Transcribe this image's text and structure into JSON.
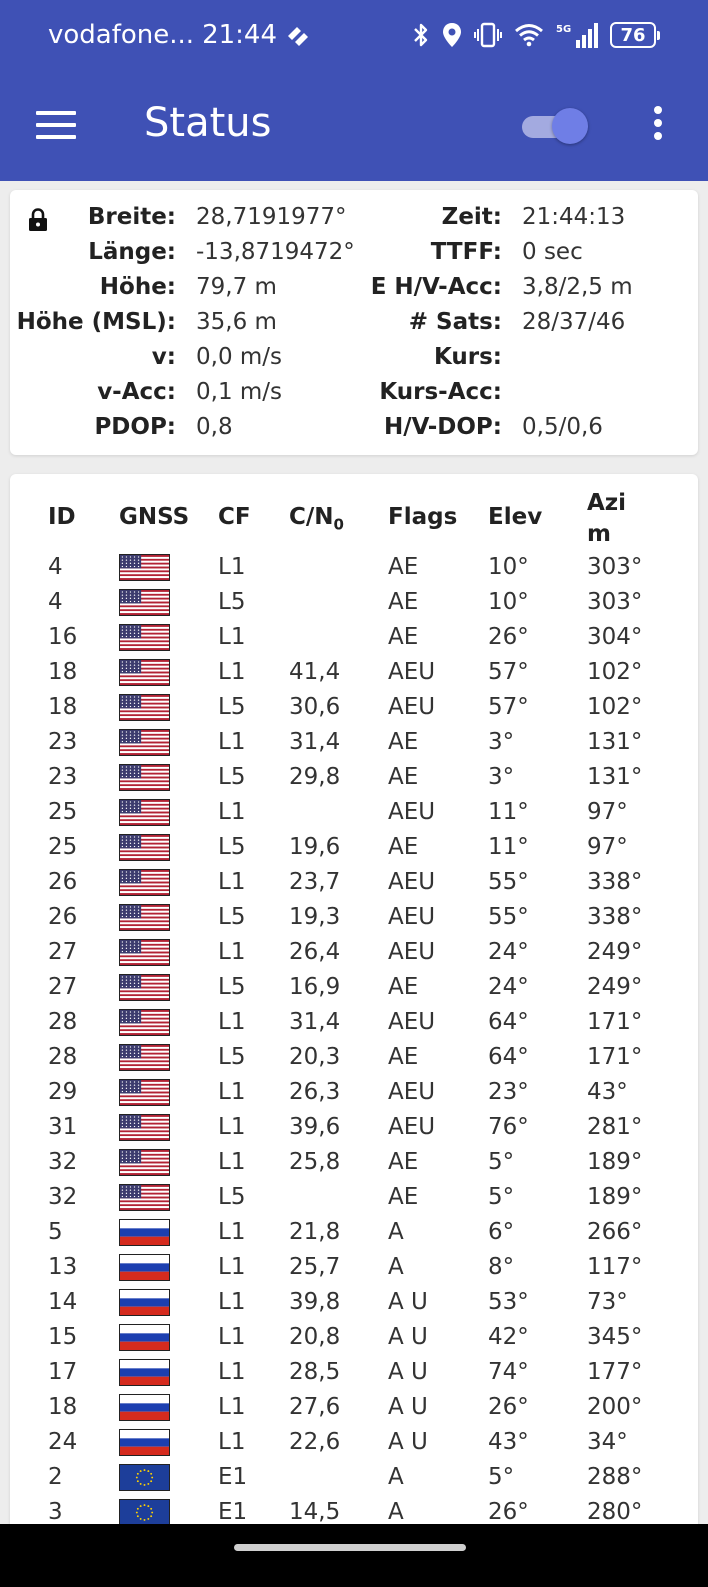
{
  "status_bar": {
    "carrier": "vodafone...",
    "time": "21:44",
    "network": "5G",
    "battery": "76"
  },
  "app_bar": {
    "title": "Status"
  },
  "position": {
    "left": [
      {
        "label": "Breite:",
        "value": "28,7191977°"
      },
      {
        "label": "Länge:",
        "value": "-13,8719472°"
      },
      {
        "label": "Höhe:",
        "value": "79,7 m"
      },
      {
        "label": "Höhe (MSL):",
        "value": "35,6 m"
      },
      {
        "label": "v:",
        "value": "0,0 m/s"
      },
      {
        "label": "v-Acc:",
        "value": "0,1 m/s"
      },
      {
        "label": "PDOP:",
        "value": "0,8"
      }
    ],
    "right": [
      {
        "label": "Zeit:",
        "value": "21:44:13"
      },
      {
        "label": "TTFF:",
        "value": "0 sec"
      },
      {
        "label": "E H/V-Acc:",
        "value": "3,8/2,5 m"
      },
      {
        "label": "# Sats:",
        "value": "28/37/46"
      },
      {
        "label": "Kurs:",
        "value": ""
      },
      {
        "label": "Kurs-Acc:",
        "value": ""
      },
      {
        "label": "H/V-DOP:",
        "value": "0,5/0,6"
      }
    ]
  },
  "satellites": {
    "columns": {
      "id": "ID",
      "gnss": "GNSS",
      "cf": "CF",
      "cn0": "C/N",
      "cn0_sub": "0",
      "flags": "Flags",
      "elev": "Elev",
      "azim_1": "Azi",
      "azim_2": "m"
    },
    "rows": [
      {
        "id": "4",
        "gnss": "us",
        "cf": "L1",
        "cn0": "",
        "flags": "AE",
        "elev": "10°",
        "azim": "303°"
      },
      {
        "id": "4",
        "gnss": "us",
        "cf": "L5",
        "cn0": "",
        "flags": "AE",
        "elev": "10°",
        "azim": "303°"
      },
      {
        "id": "16",
        "gnss": "us",
        "cf": "L1",
        "cn0": "",
        "flags": "AE",
        "elev": "26°",
        "azim": "304°"
      },
      {
        "id": "18",
        "gnss": "us",
        "cf": "L1",
        "cn0": "41,4",
        "flags": "AEU",
        "elev": "57°",
        "azim": "102°"
      },
      {
        "id": "18",
        "gnss": "us",
        "cf": "L5",
        "cn0": "30,6",
        "flags": "AEU",
        "elev": "57°",
        "azim": "102°"
      },
      {
        "id": "23",
        "gnss": "us",
        "cf": "L1",
        "cn0": "31,4",
        "flags": "AE",
        "elev": "3°",
        "azim": "131°"
      },
      {
        "id": "23",
        "gnss": "us",
        "cf": "L5",
        "cn0": "29,8",
        "flags": "AE",
        "elev": "3°",
        "azim": "131°"
      },
      {
        "id": "25",
        "gnss": "us",
        "cf": "L1",
        "cn0": "",
        "flags": "AEU",
        "elev": "11°",
        "azim": "97°"
      },
      {
        "id": "25",
        "gnss": "us",
        "cf": "L5",
        "cn0": "19,6",
        "flags": "AE",
        "elev": "11°",
        "azim": "97°"
      },
      {
        "id": "26",
        "gnss": "us",
        "cf": "L1",
        "cn0": "23,7",
        "flags": "AEU",
        "elev": "55°",
        "azim": "338°"
      },
      {
        "id": "26",
        "gnss": "us",
        "cf": "L5",
        "cn0": "19,3",
        "flags": "AEU",
        "elev": "55°",
        "azim": "338°"
      },
      {
        "id": "27",
        "gnss": "us",
        "cf": "L1",
        "cn0": "26,4",
        "flags": "AEU",
        "elev": "24°",
        "azim": "249°"
      },
      {
        "id": "27",
        "gnss": "us",
        "cf": "L5",
        "cn0": "16,9",
        "flags": "AE",
        "elev": "24°",
        "azim": "249°"
      },
      {
        "id": "28",
        "gnss": "us",
        "cf": "L1",
        "cn0": "31,4",
        "flags": "AEU",
        "elev": "64°",
        "azim": "171°"
      },
      {
        "id": "28",
        "gnss": "us",
        "cf": "L5",
        "cn0": "20,3",
        "flags": "AE",
        "elev": "64°",
        "azim": "171°"
      },
      {
        "id": "29",
        "gnss": "us",
        "cf": "L1",
        "cn0": "26,3",
        "flags": "AEU",
        "elev": "23°",
        "azim": "43°"
      },
      {
        "id": "31",
        "gnss": "us",
        "cf": "L1",
        "cn0": "39,6",
        "flags": "AEU",
        "elev": "76°",
        "azim": "281°"
      },
      {
        "id": "32",
        "gnss": "us",
        "cf": "L1",
        "cn0": "25,8",
        "flags": "AE",
        "elev": "5°",
        "azim": "189°"
      },
      {
        "id": "32",
        "gnss": "us",
        "cf": "L5",
        "cn0": "",
        "flags": "AE",
        "elev": "5°",
        "azim": "189°"
      },
      {
        "id": "5",
        "gnss": "ru",
        "cf": "L1",
        "cn0": "21,8",
        "flags": "A",
        "elev": "6°",
        "azim": "266°"
      },
      {
        "id": "13",
        "gnss": "ru",
        "cf": "L1",
        "cn0": "25,7",
        "flags": "A",
        "elev": "8°",
        "azim": "117°"
      },
      {
        "id": "14",
        "gnss": "ru",
        "cf": "L1",
        "cn0": "39,8",
        "flags": "A U",
        "elev": "53°",
        "azim": "73°"
      },
      {
        "id": "15",
        "gnss": "ru",
        "cf": "L1",
        "cn0": "20,8",
        "flags": "A U",
        "elev": "42°",
        "azim": "345°"
      },
      {
        "id": "17",
        "gnss": "ru",
        "cf": "L1",
        "cn0": "28,5",
        "flags": "A U",
        "elev": "74°",
        "azim": "177°"
      },
      {
        "id": "18",
        "gnss": "ru",
        "cf": "L1",
        "cn0": "27,6",
        "flags": "A U",
        "elev": "26°",
        "azim": "200°"
      },
      {
        "id": "24",
        "gnss": "ru",
        "cf": "L1",
        "cn0": "22,6",
        "flags": "A U",
        "elev": "43°",
        "azim": "34°"
      },
      {
        "id": "2",
        "gnss": "eu",
        "cf": "E1",
        "cn0": "",
        "flags": "A",
        "elev": "5°",
        "azim": "288°"
      },
      {
        "id": "3",
        "gnss": "eu",
        "cf": "E1",
        "cn0": "14,5",
        "flags": "A",
        "elev": "26°",
        "azim": "280°"
      }
    ]
  },
  "icons": {
    "bluetooth": "bluetooth-icon",
    "location": "location-icon",
    "vibrate": "vibrate-icon",
    "wifi": "wifi-icon",
    "signal": "signal-icon",
    "lock": "lock-icon"
  },
  "colors": {
    "app_bar": "#3f51b5",
    "toggle_thumb": "#6f7ee6",
    "toggle_track": "#a3aae0",
    "background": "#ededed"
  }
}
